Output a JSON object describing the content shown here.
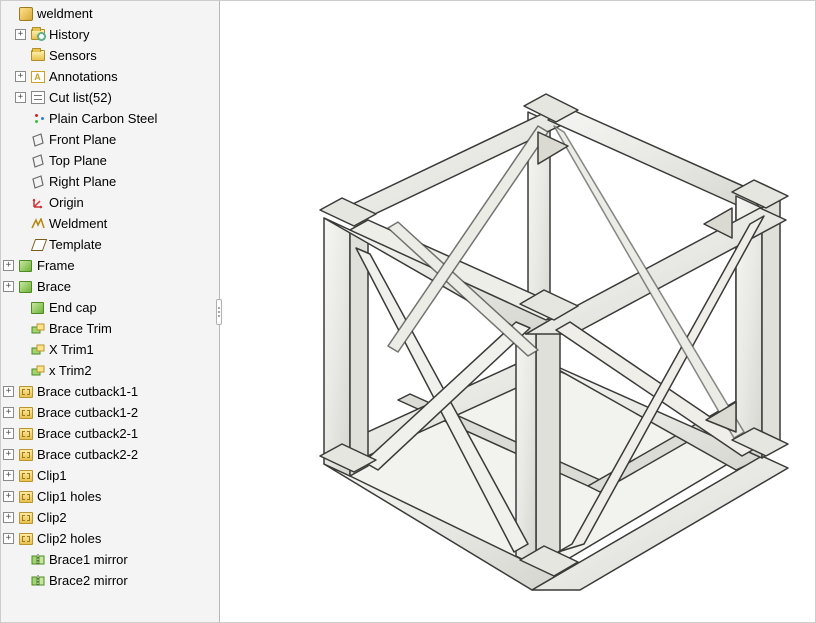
{
  "root": {
    "label": "weldment"
  },
  "tree": [
    {
      "label": "History",
      "icon": "folder-clock",
      "exp": "+",
      "indent": 1
    },
    {
      "label": "Sensors",
      "icon": "folder",
      "exp": "",
      "indent": 1
    },
    {
      "label": "Annotations",
      "icon": "anno",
      "exp": "+",
      "indent": 1
    },
    {
      "label": "Cut list(52)",
      "icon": "cutlist",
      "exp": "+",
      "indent": 1
    },
    {
      "label": "Plain Carbon Steel",
      "icon": "material",
      "exp": "",
      "indent": 1
    },
    {
      "label": "Front Plane",
      "icon": "plane",
      "exp": "",
      "indent": 1
    },
    {
      "label": "Top Plane",
      "icon": "plane",
      "exp": "",
      "indent": 1
    },
    {
      "label": "Right Plane",
      "icon": "plane",
      "exp": "",
      "indent": 1
    },
    {
      "label": "Origin",
      "icon": "origin",
      "exp": "",
      "indent": 1
    },
    {
      "label": "Weldment",
      "icon": "weld",
      "exp": "",
      "indent": 1
    },
    {
      "label": "Template",
      "icon": "sketch",
      "exp": "",
      "indent": 1
    },
    {
      "label": "Frame",
      "icon": "body",
      "exp": "+",
      "indent": 0
    },
    {
      "label": "Brace",
      "icon": "body",
      "exp": "+",
      "indent": 0
    },
    {
      "label": "End cap",
      "icon": "body",
      "exp": "",
      "indent": 1
    },
    {
      "label": "Brace Trim",
      "icon": "trim",
      "exp": "",
      "indent": 1
    },
    {
      "label": "X Trim1",
      "icon": "trim",
      "exp": "",
      "indent": 1
    },
    {
      "label": "x Trim2",
      "icon": "trim",
      "exp": "",
      "indent": 1
    },
    {
      "label": "Brace cutback1-1",
      "icon": "feat",
      "exp": "+",
      "indent": 0
    },
    {
      "label": "Brace cutback1-2",
      "icon": "feat",
      "exp": "+",
      "indent": 0
    },
    {
      "label": "Brace cutback2-1",
      "icon": "feat",
      "exp": "+",
      "indent": 0
    },
    {
      "label": "Brace cutback2-2",
      "icon": "feat",
      "exp": "+",
      "indent": 0
    },
    {
      "label": "Clip1",
      "icon": "feat",
      "exp": "+",
      "indent": 0
    },
    {
      "label": "Clip1 holes",
      "icon": "feat",
      "exp": "+",
      "indent": 0
    },
    {
      "label": "Clip2",
      "icon": "feat",
      "exp": "+",
      "indent": 0
    },
    {
      "label": "Clip2 holes",
      "icon": "feat",
      "exp": "+",
      "indent": 0
    },
    {
      "label": "Brace1 mirror",
      "icon": "mirror",
      "exp": "",
      "indent": 1
    },
    {
      "label": "Brace2 mirror",
      "icon": "mirror",
      "exp": "",
      "indent": 1
    }
  ],
  "icons": {
    "anno_text": "A"
  }
}
